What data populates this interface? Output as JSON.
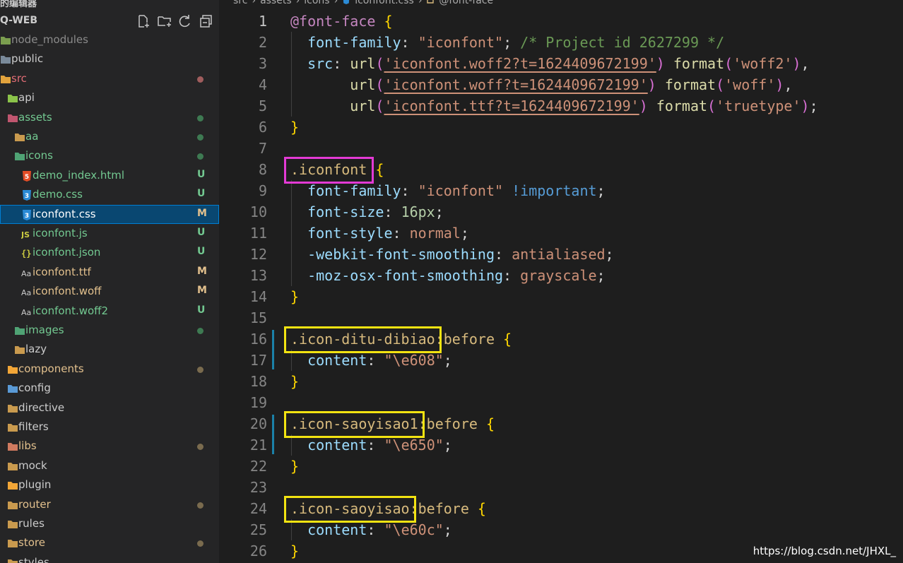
{
  "explorer": {
    "header_label": "的编辑器",
    "project_title": "Q-WEB",
    "toolbar": [
      "new-file-icon",
      "new-folder-icon",
      "refresh-icon",
      "collapse-all-icon"
    ],
    "items": [
      {
        "label": "node_modules",
        "kind": "folder",
        "color": "#8b8b8b",
        "badge": "",
        "dot": ""
      },
      {
        "label": "public",
        "kind": "folder",
        "color": "#cccccc",
        "badge": "",
        "dot": ""
      },
      {
        "label": "src",
        "kind": "folder",
        "color": "#e06c75",
        "badge": "",
        "dot": "#a05d5d"
      },
      {
        "label": "api",
        "kind": "folder",
        "color": "#cccccc",
        "badge": "",
        "dot": ""
      },
      {
        "label": "assets",
        "kind": "folder",
        "color": "#73c991",
        "badge": "",
        "dot": "#3e7a52"
      },
      {
        "label": "aa",
        "kind": "folder",
        "color": "#73c991",
        "badge": "",
        "dot": "#3e7a52"
      },
      {
        "label": "icons",
        "kind": "folder",
        "color": "#73c991",
        "badge": "",
        "dot": "#3e7a52"
      },
      {
        "label": "demo_index.html",
        "kind": "html",
        "color": "#73c991",
        "badge": "U",
        "dot": ""
      },
      {
        "label": "demo.css",
        "kind": "css",
        "color": "#73c991",
        "badge": "U",
        "dot": ""
      },
      {
        "label": "iconfont.css",
        "kind": "css",
        "color": "#ffffff",
        "badge": "M",
        "dot": ""
      },
      {
        "label": "iconfont.js",
        "kind": "js",
        "color": "#73c991",
        "badge": "U",
        "dot": ""
      },
      {
        "label": "iconfont.json",
        "kind": "json",
        "color": "#73c991",
        "badge": "U",
        "dot": ""
      },
      {
        "label": "iconfont.ttf",
        "kind": "font",
        "color": "#e2c08d",
        "badge": "M",
        "dot": ""
      },
      {
        "label": "iconfont.woff",
        "kind": "font",
        "color": "#e2c08d",
        "badge": "M",
        "dot": ""
      },
      {
        "label": "iconfont.woff2",
        "kind": "font",
        "color": "#73c991",
        "badge": "U",
        "dot": ""
      },
      {
        "label": "images",
        "kind": "folder",
        "color": "#73c991",
        "badge": "",
        "dot": "#3e7a52"
      },
      {
        "label": "lazy",
        "kind": "folder",
        "color": "#cccccc",
        "badge": "",
        "dot": ""
      },
      {
        "label": "components",
        "kind": "folder",
        "color": "#e2c08d",
        "badge": "",
        "dot": "#7a6b4e"
      },
      {
        "label": "config",
        "kind": "folder",
        "color": "#cccccc",
        "badge": "",
        "dot": ""
      },
      {
        "label": "directive",
        "kind": "folder",
        "color": "#cccccc",
        "badge": "",
        "dot": ""
      },
      {
        "label": "filters",
        "kind": "folder",
        "color": "#cccccc",
        "badge": "",
        "dot": ""
      },
      {
        "label": "libs",
        "kind": "folder",
        "color": "#e2c08d",
        "badge": "",
        "dot": "#7a6b4e"
      },
      {
        "label": "mock",
        "kind": "folder",
        "color": "#cccccc",
        "badge": "",
        "dot": ""
      },
      {
        "label": "plugin",
        "kind": "folder",
        "color": "#cccccc",
        "badge": "",
        "dot": ""
      },
      {
        "label": "router",
        "kind": "folder",
        "color": "#e2c08d",
        "badge": "",
        "dot": "#7a6b4e"
      },
      {
        "label": "rules",
        "kind": "folder",
        "color": "#cccccc",
        "badge": "",
        "dot": ""
      },
      {
        "label": "store",
        "kind": "folder",
        "color": "#e2c08d",
        "badge": "",
        "dot": "#7a6b4e"
      },
      {
        "label": "styles",
        "kind": "folder",
        "color": "#cccccc",
        "badge": "",
        "dot": ""
      }
    ],
    "selected_label": "iconfont.css"
  },
  "breadcrumb": {
    "parts": [
      "src",
      "assets",
      "icons",
      "iconfont.css",
      "@font-face"
    ]
  },
  "editor": {
    "lines": [
      {
        "n": "1",
        "tokens": [
          [
            "@font-face",
            "at"
          ],
          [
            " ",
            "punc"
          ],
          [
            "{",
            "brace"
          ]
        ]
      },
      {
        "n": "2",
        "tokens": [
          [
            "  ",
            "punc"
          ],
          [
            "font-family",
            "prop"
          ],
          [
            ": ",
            "punc"
          ],
          [
            "\"iconfont\"",
            "str"
          ],
          [
            "; ",
            "punc"
          ],
          [
            "/* Project id 2627299 */",
            "comment"
          ]
        ]
      },
      {
        "n": "3",
        "tokens": [
          [
            "  ",
            "punc"
          ],
          [
            "src",
            "prop"
          ],
          [
            ": ",
            "punc"
          ],
          [
            "url",
            "fn"
          ],
          [
            "(",
            "paren"
          ],
          [
            "'iconfont.woff2?t=1624409672199'",
            "url"
          ],
          [
            ")",
            "paren"
          ],
          [
            " ",
            "punc"
          ],
          [
            "format",
            "fn"
          ],
          [
            "(",
            "paren"
          ],
          [
            "'woff2'",
            "str"
          ],
          [
            ")",
            "paren"
          ],
          [
            ",",
            "punc"
          ]
        ]
      },
      {
        "n": "4",
        "tokens": [
          [
            "       ",
            "punc"
          ],
          [
            "url",
            "fn"
          ],
          [
            "(",
            "paren"
          ],
          [
            "'iconfont.woff?t=1624409672199'",
            "url"
          ],
          [
            ")",
            "paren"
          ],
          [
            " ",
            "punc"
          ],
          [
            "format",
            "fn"
          ],
          [
            "(",
            "paren"
          ],
          [
            "'woff'",
            "str"
          ],
          [
            ")",
            "paren"
          ],
          [
            ",",
            "punc"
          ]
        ]
      },
      {
        "n": "5",
        "tokens": [
          [
            "       ",
            "punc"
          ],
          [
            "url",
            "fn"
          ],
          [
            "(",
            "paren"
          ],
          [
            "'iconfont.ttf?t=1624409672199'",
            "url"
          ],
          [
            ")",
            "paren"
          ],
          [
            " ",
            "punc"
          ],
          [
            "format",
            "fn"
          ],
          [
            "(",
            "paren"
          ],
          [
            "'truetype'",
            "str"
          ],
          [
            ")",
            "paren"
          ],
          [
            ";",
            "punc"
          ]
        ]
      },
      {
        "n": "6",
        "tokens": [
          [
            "}",
            "brace"
          ]
        ]
      },
      {
        "n": "7",
        "tokens": []
      },
      {
        "n": "8",
        "tokens": [
          [
            ".iconfont",
            "sel"
          ],
          [
            " ",
            "punc"
          ],
          [
            "{",
            "brace"
          ]
        ]
      },
      {
        "n": "9",
        "tokens": [
          [
            "  ",
            "punc"
          ],
          [
            "font-family",
            "prop"
          ],
          [
            ": ",
            "punc"
          ],
          [
            "\"iconfont\"",
            "str"
          ],
          [
            " ",
            "punc"
          ],
          [
            "!important",
            "kw"
          ],
          [
            ";",
            "punc"
          ]
        ]
      },
      {
        "n": "10",
        "tokens": [
          [
            "  ",
            "punc"
          ],
          [
            "font-size",
            "prop"
          ],
          [
            ": ",
            "punc"
          ],
          [
            "16px",
            "num"
          ],
          [
            ";",
            "punc"
          ]
        ]
      },
      {
        "n": "11",
        "tokens": [
          [
            "  ",
            "punc"
          ],
          [
            "font-style",
            "prop"
          ],
          [
            ": ",
            "punc"
          ],
          [
            "normal",
            "str"
          ],
          [
            ";",
            "punc"
          ]
        ]
      },
      {
        "n": "12",
        "tokens": [
          [
            "  ",
            "punc"
          ],
          [
            "-webkit-font-smoothing",
            "prop"
          ],
          [
            ": ",
            "punc"
          ],
          [
            "antialiased",
            "str"
          ],
          [
            ";",
            "punc"
          ]
        ]
      },
      {
        "n": "13",
        "tokens": [
          [
            "  ",
            "punc"
          ],
          [
            "-moz-osx-font-smoothing",
            "prop"
          ],
          [
            ": ",
            "punc"
          ],
          [
            "grayscale",
            "str"
          ],
          [
            ";",
            "punc"
          ]
        ]
      },
      {
        "n": "14",
        "tokens": [
          [
            "}",
            "brace"
          ]
        ]
      },
      {
        "n": "15",
        "tokens": []
      },
      {
        "n": "16",
        "tokens": [
          [
            ".icon-ditu-dibiao",
            "sel"
          ],
          [
            ":before",
            "sel"
          ],
          [
            " ",
            "punc"
          ],
          [
            "{",
            "brace"
          ]
        ]
      },
      {
        "n": "17",
        "tokens": [
          [
            "  ",
            "punc"
          ],
          [
            "content",
            "prop"
          ],
          [
            ": ",
            "punc"
          ],
          [
            "\"\\e608\"",
            "str"
          ],
          [
            ";",
            "punc"
          ]
        ]
      },
      {
        "n": "18",
        "tokens": [
          [
            "}",
            "brace"
          ]
        ]
      },
      {
        "n": "19",
        "tokens": []
      },
      {
        "n": "20",
        "tokens": [
          [
            ".icon-saoyisao1",
            "sel"
          ],
          [
            ":before",
            "sel"
          ],
          [
            " ",
            "punc"
          ],
          [
            "{",
            "brace"
          ]
        ]
      },
      {
        "n": "21",
        "tokens": [
          [
            "  ",
            "punc"
          ],
          [
            "content",
            "prop"
          ],
          [
            ": ",
            "punc"
          ],
          [
            "\"\\e650\"",
            "str"
          ],
          [
            ";",
            "punc"
          ]
        ]
      },
      {
        "n": "22",
        "tokens": [
          [
            "}",
            "brace"
          ]
        ]
      },
      {
        "n": "23",
        "tokens": []
      },
      {
        "n": "24",
        "tokens": [
          [
            ".icon-saoyisao",
            "sel"
          ],
          [
            ":before",
            "sel"
          ],
          [
            " ",
            "punc"
          ],
          [
            "{",
            "brace"
          ]
        ]
      },
      {
        "n": "25",
        "tokens": [
          [
            "  ",
            "punc"
          ],
          [
            "content",
            "prop"
          ],
          [
            ": ",
            "punc"
          ],
          [
            "\"\\e60c\"",
            "str"
          ],
          [
            ";",
            "punc"
          ]
        ]
      },
      {
        "n": "26",
        "tokens": [
          [
            "}",
            "brace"
          ]
        ]
      }
    ],
    "active_line": "1"
  },
  "annotations": [
    {
      "target_line": "8",
      "color": "#e33ad5"
    },
    {
      "target_line": "16",
      "color": "#f2e311"
    },
    {
      "target_line": "20",
      "color": "#f2e311"
    },
    {
      "target_line": "24",
      "color": "#f2e311"
    }
  ],
  "watermark": "https://blog.csdn.net/JHXL_",
  "colors": {
    "sidebar_bg": "#252526",
    "editor_bg": "#1e1e1e",
    "selection": "#094771",
    "untracked": "#73c991",
    "modified": "#e2c08d"
  }
}
